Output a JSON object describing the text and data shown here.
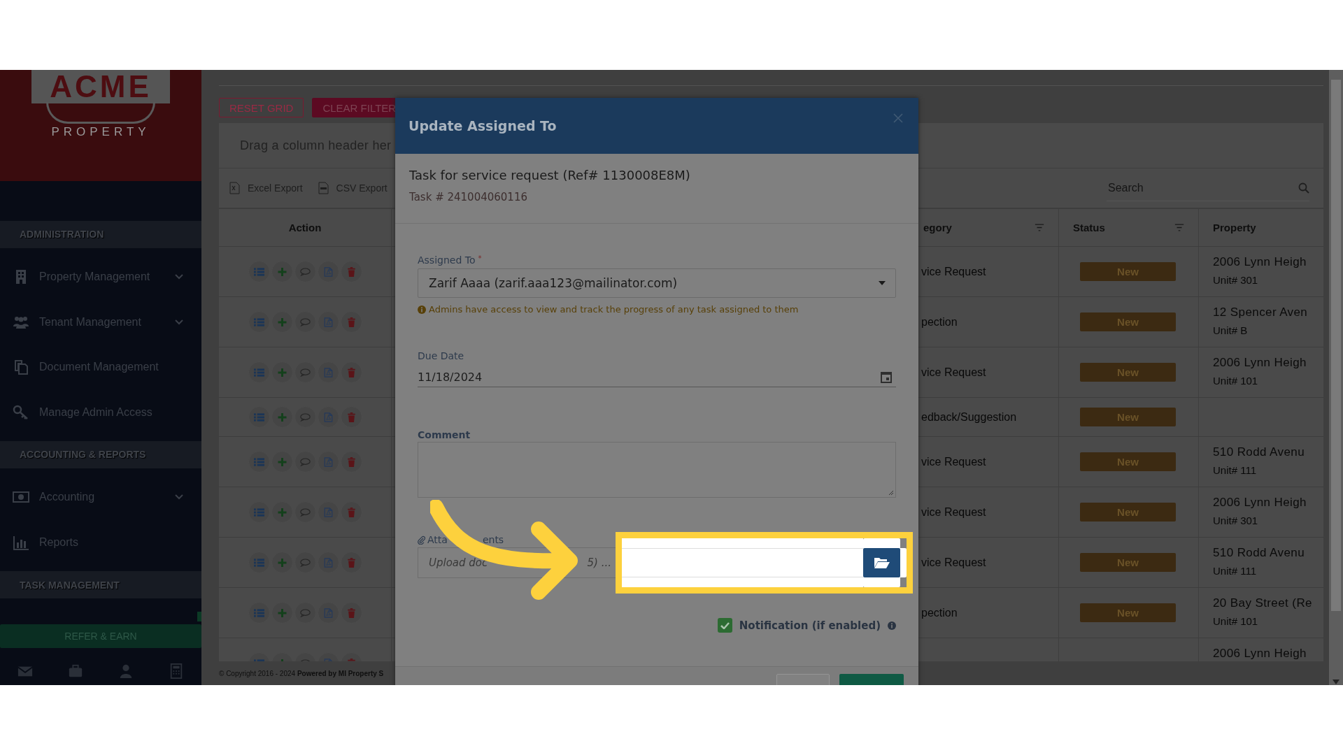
{
  "sidebar": {
    "logo": {
      "word": "ACME",
      "tagline": "PROPERTY"
    },
    "sections": [
      {
        "title": "ADMINISTRATION",
        "items": [
          {
            "label": "Property Management",
            "kind": "building",
            "has_submenu": true
          },
          {
            "label": "Tenant Management",
            "kind": "users",
            "has_submenu": true
          },
          {
            "label": "Document Management",
            "kind": "documents",
            "has_submenu": false
          },
          {
            "label": "Manage Admin Access",
            "kind": "key",
            "has_submenu": false
          }
        ]
      },
      {
        "title": "ACCOUNTING & REPORTS",
        "items": [
          {
            "label": "Accounting",
            "kind": "money",
            "has_submenu": true
          },
          {
            "label": "Reports",
            "kind": "chart",
            "has_submenu": false
          }
        ]
      },
      {
        "title": "TASK MANAGEMENT"
      }
    ],
    "refer_button": "REFER & EARN"
  },
  "toolbar": {
    "buttons": [
      {
        "label": "RESET GRID",
        "kind": "outline"
      },
      {
        "label": "CLEAR FILTER",
        "kind": "filled"
      }
    ]
  },
  "grid": {
    "group_hint": "Drag a column header her",
    "exports": [
      {
        "label": "Excel Export",
        "kind": "excel"
      },
      {
        "label": "CSV Export",
        "kind": "csv"
      }
    ],
    "search": {
      "placeholder": "Search"
    },
    "columns": [
      {
        "label": "Action",
        "filter": false
      },
      {
        "label": "egory",
        "filter": true
      },
      {
        "label": "Status",
        "filter": true
      },
      {
        "label": "Property",
        "filter": false
      }
    ],
    "rows": [
      {
        "category": "vice Request",
        "status": "New",
        "property": "2006 Lynn Heigh",
        "unit": "Unit# 301"
      },
      {
        "category": "pection",
        "status": "New",
        "property": "12 Spencer Aven",
        "unit": "Unit# B"
      },
      {
        "category": "vice Request",
        "status": "New",
        "property": "2006 Lynn Heigh",
        "unit": "Unit# 101"
      },
      {
        "category": "edback/Suggestion",
        "status": "New"
      },
      {
        "category": "vice Request",
        "status": "New",
        "property": "510 Rodd Avenu",
        "unit": "Unit# 111"
      },
      {
        "category": "vice Request",
        "status": "New",
        "property": "2006 Lynn Heigh",
        "unit": "Unit# 301"
      },
      {
        "category": "vice Request",
        "status": "New",
        "property": "510 Rodd Avenu",
        "unit": "Unit# 111"
      },
      {
        "category": "pection",
        "status": "New",
        "property": "20 Bay Street (Re",
        "unit": "Unit# 101"
      },
      {
        "property": "2006 Lynn Heigh"
      }
    ]
  },
  "footer": "© Copyright 2016 - 2024 **Powered by MI Property S**",
  "modal": {
    "title": "Update Assigned To",
    "heading": "Task for service request (Ref# 1130008E8M)",
    "task_number": "Task # 241004060116",
    "assigned_to": {
      "label": "Assigned To",
      "required_mark": "*",
      "value": "Zarif Aaaa (zarif.aaa123@mailinator.com)"
    },
    "hint": "Admins have access to view and track the progress of any task assigned to them",
    "due_date": {
      "label": "Due Date",
      "value": "11/18/2024"
    },
    "comment": {
      "label": "Comment"
    },
    "attachments": {
      "label_parts": [
        "Atta",
        "ents"
      ],
      "placeholder_parts": [
        "Upload doc",
        "5) ..."
      ]
    },
    "notification": {
      "label": "Notification (if enabled)",
      "checked": true
    },
    "footer_buttons": [
      {
        "kind": "secondary"
      },
      {
        "kind": "primary"
      }
    ]
  }
}
